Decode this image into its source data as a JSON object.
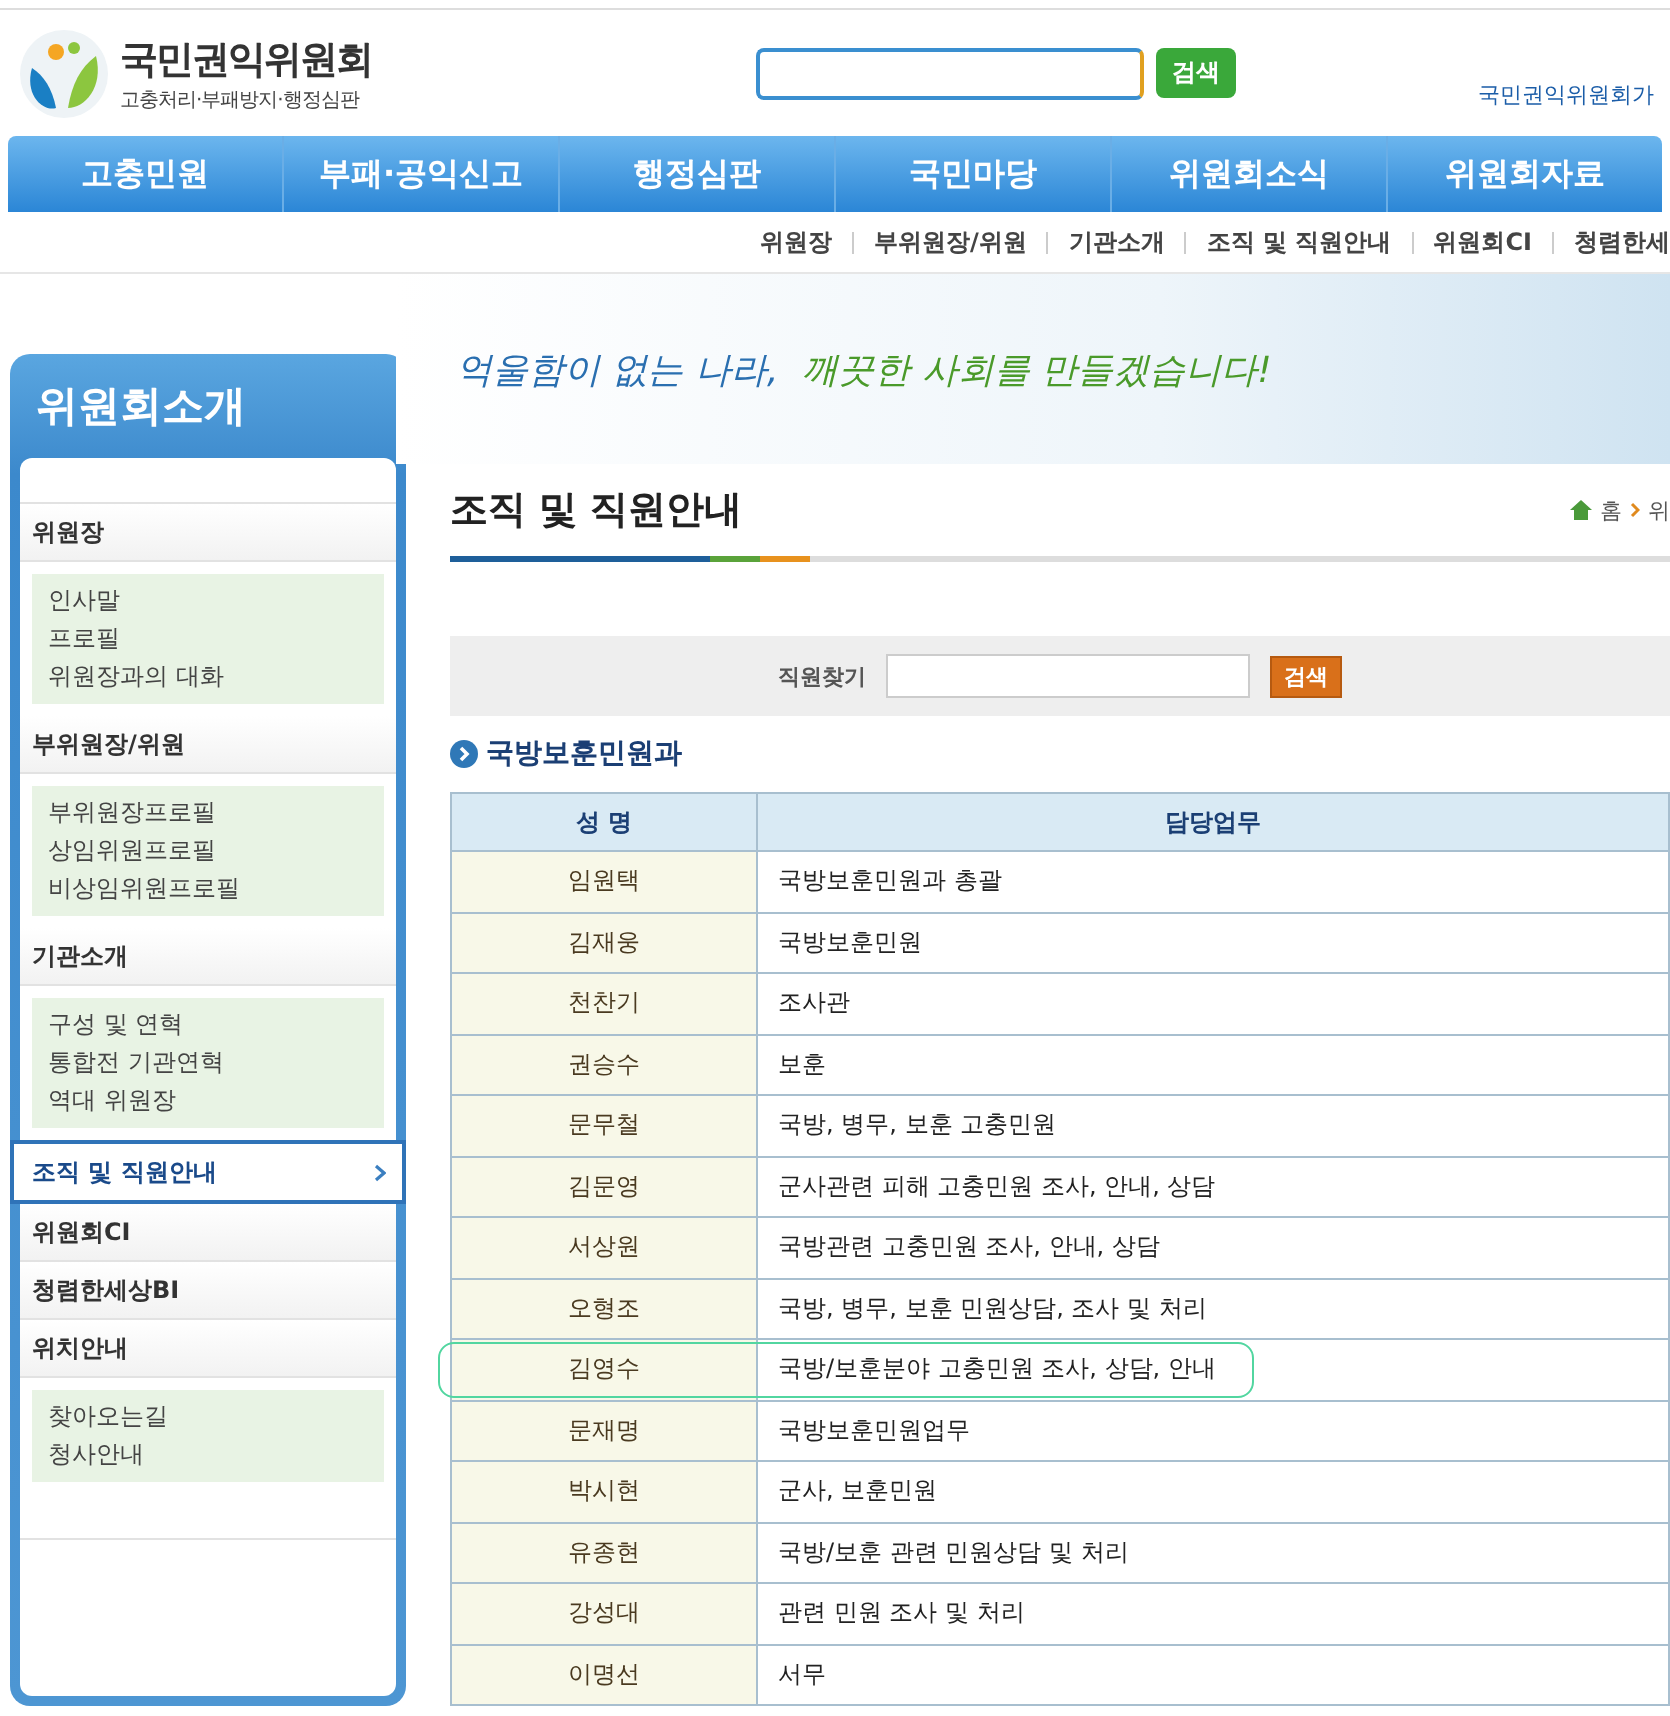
{
  "header": {
    "logo_title": "국민권익위원회",
    "logo_subtitle": "고충처리·부패방지·행정심판",
    "search_button": "검색",
    "right_text": "국민권익위원회가"
  },
  "main_nav": [
    {
      "label": "고충민원",
      "selected": false
    },
    {
      "label": "부패·공익신고",
      "selected": false
    },
    {
      "label": "행정심판",
      "selected": false
    },
    {
      "label": "국민마당",
      "selected": false
    },
    {
      "label": "위원회소식",
      "selected": false
    },
    {
      "label": "위원회자료",
      "selected": false
    }
  ],
  "sub_nav": [
    {
      "label": "위원장",
      "selected": false
    },
    {
      "label": "부위원장/위원",
      "selected": false
    },
    {
      "label": "기관소개",
      "selected": false
    },
    {
      "label": "조직 및 직원안내",
      "selected": false
    },
    {
      "label": "위원회CI",
      "selected": false
    },
    {
      "label": "청렴한세",
      "selected": false
    }
  ],
  "banner": {
    "slogan_1": "억울함이 없는 나라,",
    "slogan_2": "깨끗한 사회를 만들겠습니다!"
  },
  "sidebar": {
    "title": "위원회소개",
    "items": [
      {
        "label": "위원장",
        "selected": false,
        "children": [
          {
            "label": "인사말"
          },
          {
            "label": "프로필"
          },
          {
            "label": "위원장과의 대화"
          }
        ]
      },
      {
        "label": "부위원장/위원",
        "selected": false,
        "children": [
          {
            "label": "부위원장프로필"
          },
          {
            "label": "상임위원프로필"
          },
          {
            "label": "비상임위원프로필"
          }
        ]
      },
      {
        "label": "기관소개",
        "selected": false,
        "children": [
          {
            "label": "구성 및 연혁"
          },
          {
            "label": "통합전 기관연혁"
          },
          {
            "label": "역대 위원장"
          }
        ]
      },
      {
        "label": "조직 및 직원안내",
        "selected": true
      },
      {
        "label": "위원회CI",
        "selected": false
      },
      {
        "label": "청렴한세상BI",
        "selected": false
      },
      {
        "label": "위치안내",
        "selected": false,
        "children": [
          {
            "label": "찾아오는길"
          },
          {
            "label": "청사안내"
          }
        ]
      }
    ]
  },
  "page_title": "조직 및 직원안내",
  "breadcrumb": [
    "홈",
    "위"
  ],
  "staff_search": {
    "label": "직원찾기",
    "button": "검색"
  },
  "section_title": "국방보훈민원과",
  "table": {
    "columns": [
      "성 명",
      "담당업무"
    ],
    "rows": [
      {
        "name": "임원택",
        "duty": "국방보훈민원과 총괄",
        "highlighted": false
      },
      {
        "name": "김재웅",
        "duty": "국방보훈민원",
        "highlighted": false
      },
      {
        "name": "천찬기",
        "duty": "조사관",
        "highlighted": false
      },
      {
        "name": "권승수",
        "duty": "보훈",
        "highlighted": false
      },
      {
        "name": "문무철",
        "duty": "국방, 병무, 보훈 고충민원",
        "highlighted": false
      },
      {
        "name": "김문영",
        "duty": "군사관련 피해 고충민원 조사, 안내, 상담",
        "highlighted": false
      },
      {
        "name": "서상원",
        "duty": "국방관련 고충민원 조사, 안내, 상담",
        "highlighted": false
      },
      {
        "name": "오형조",
        "duty": "국방, 병무, 보훈 민원상담, 조사 및 처리",
        "highlighted": false
      },
      {
        "name": "김영수",
        "duty": "국방/보훈분야 고충민원 조사, 상담, 안내",
        "highlighted": true
      },
      {
        "name": "문재명",
        "duty": "국방보훈민원업무",
        "highlighted": false
      },
      {
        "name": "박시현",
        "duty": "군사, 보훈민원",
        "highlighted": false
      },
      {
        "name": "유종현",
        "duty": "국방/보훈 관련 민원상담 및 처리",
        "highlighted": false
      },
      {
        "name": "강성대",
        "duty": "관련 민원 조사 및 처리",
        "highlighted": false
      },
      {
        "name": "이명선",
        "duty": "서무",
        "highlighted": false
      }
    ]
  }
}
